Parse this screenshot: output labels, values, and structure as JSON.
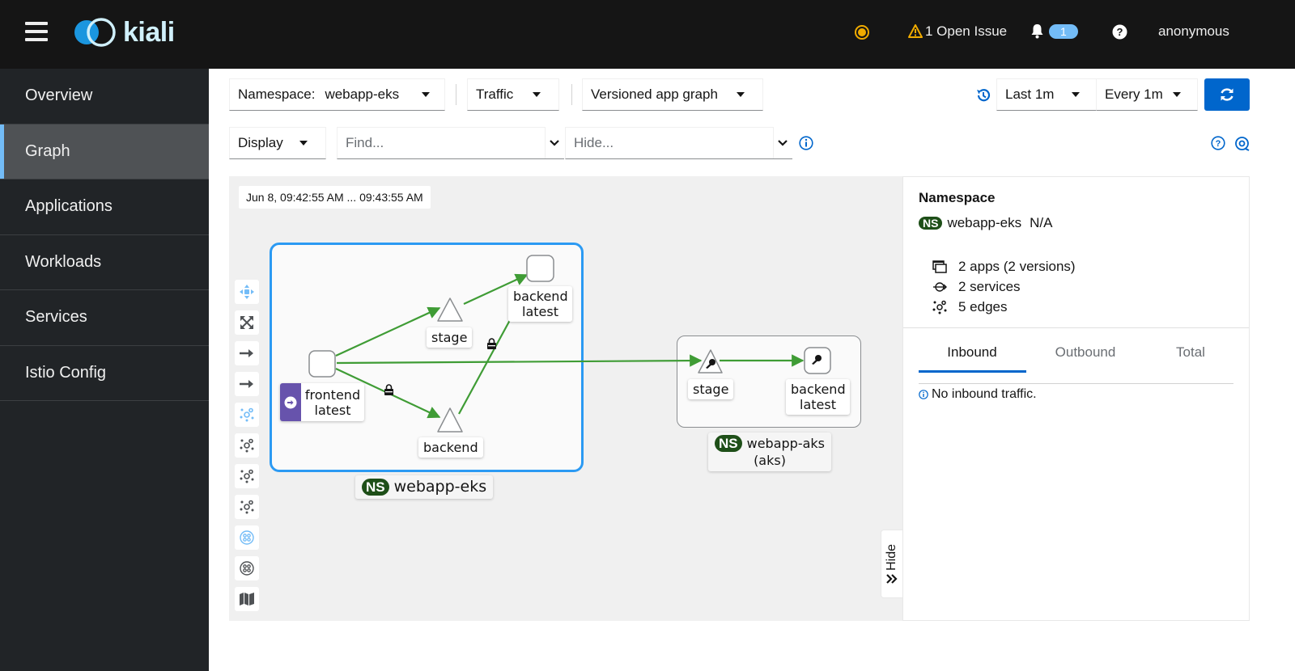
{
  "header": {
    "logo_text": "kiali",
    "open_issues_label": "1 Open Issue",
    "notifications_count": "1",
    "user": "anonymous",
    "status_color": "#f0ab00"
  },
  "sidebar": {
    "items": [
      {
        "label": "Overview",
        "active": false
      },
      {
        "label": "Graph",
        "active": true
      },
      {
        "label": "Applications",
        "active": false
      },
      {
        "label": "Workloads",
        "active": false
      },
      {
        "label": "Services",
        "active": false
      },
      {
        "label": "Istio Config",
        "active": false
      }
    ]
  },
  "toolbar": {
    "namespace_label": "Namespace:",
    "namespace_value": "webapp-eks",
    "traffic_label": "Traffic",
    "graph_type": "Versioned app graph",
    "display_label": "Display",
    "find_placeholder": "Find...",
    "hide_placeholder": "Hide...",
    "duration": "Last 1m",
    "refresh_interval": "Every 1m"
  },
  "graph": {
    "timestamp": "Jun 8, 09:42:55 AM ... 09:43:55 AM",
    "namespaces": [
      {
        "name": "webapp-eks",
        "selected": true
      },
      {
        "name": "webapp-aks",
        "cluster": "(aks)",
        "selected": false
      }
    ],
    "nodes": [
      {
        "id": "frontend",
        "label1": "frontend",
        "label2": "latest",
        "shape": "app",
        "namespace": "webapp-eks",
        "badge": "root"
      },
      {
        "id": "stage-eks",
        "label1": "stage",
        "shape": "service",
        "namespace": "webapp-eks"
      },
      {
        "id": "backend-svc-eks",
        "label1": "backend",
        "shape": "service",
        "namespace": "webapp-eks"
      },
      {
        "id": "backend-latest-eks",
        "label1": "backend",
        "label2": "latest",
        "shape": "app",
        "namespace": "webapp-eks"
      },
      {
        "id": "stage-aks",
        "label1": "stage",
        "shape": "service",
        "namespace": "webapp-aks",
        "icon": "key"
      },
      {
        "id": "backend-latest-aks",
        "label1": "backend",
        "label2": "latest",
        "shape": "app",
        "namespace": "webapp-aks",
        "icon": "key"
      }
    ],
    "edges": [
      {
        "from": "frontend",
        "to": "stage-eks",
        "mtls": false
      },
      {
        "from": "stage-eks",
        "to": "backend-latest-eks",
        "mtls": false
      },
      {
        "from": "frontend",
        "to": "backend-svc-eks",
        "mtls": true
      },
      {
        "from": "backend-svc-eks",
        "to": "backend-latest-eks",
        "mtls": true
      },
      {
        "from": "frontend",
        "to": "stage-aks",
        "mtls": false
      },
      {
        "from": "stage-aks",
        "to": "backend-latest-aks",
        "mtls": false
      }
    ],
    "edge_color": "#3f9c35",
    "hide_label": "Hide"
  },
  "side_panel": {
    "title": "Namespace",
    "namespace": "webapp-eks",
    "namespace_status": "N/A",
    "stats": [
      {
        "icon": "applications-icon",
        "text": "2 apps (2 versions)"
      },
      {
        "icon": "services-icon",
        "text": "2 services"
      },
      {
        "icon": "edges-icon",
        "text": "5 edges"
      }
    ],
    "tabs": [
      "Inbound",
      "Outbound",
      "Total"
    ],
    "active_tab": "Inbound",
    "message": "No inbound traffic."
  }
}
